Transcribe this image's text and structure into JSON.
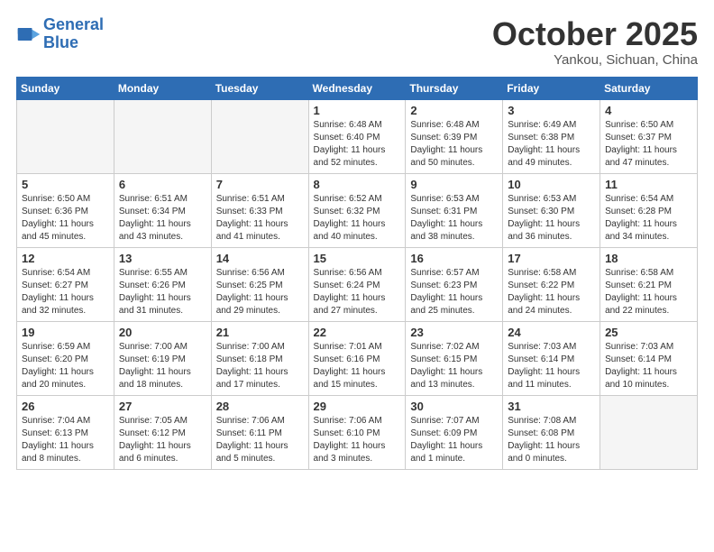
{
  "header": {
    "logo_line1": "General",
    "logo_line2": "Blue",
    "month": "October 2025",
    "location": "Yankou, Sichuan, China"
  },
  "weekdays": [
    "Sunday",
    "Monday",
    "Tuesday",
    "Wednesday",
    "Thursday",
    "Friday",
    "Saturday"
  ],
  "weeks": [
    [
      {
        "day": "",
        "info": ""
      },
      {
        "day": "",
        "info": ""
      },
      {
        "day": "",
        "info": ""
      },
      {
        "day": "1",
        "info": "Sunrise: 6:48 AM\nSunset: 6:40 PM\nDaylight: 11 hours\nand 52 minutes."
      },
      {
        "day": "2",
        "info": "Sunrise: 6:48 AM\nSunset: 6:39 PM\nDaylight: 11 hours\nand 50 minutes."
      },
      {
        "day": "3",
        "info": "Sunrise: 6:49 AM\nSunset: 6:38 PM\nDaylight: 11 hours\nand 49 minutes."
      },
      {
        "day": "4",
        "info": "Sunrise: 6:50 AM\nSunset: 6:37 PM\nDaylight: 11 hours\nand 47 minutes."
      }
    ],
    [
      {
        "day": "5",
        "info": "Sunrise: 6:50 AM\nSunset: 6:36 PM\nDaylight: 11 hours\nand 45 minutes."
      },
      {
        "day": "6",
        "info": "Sunrise: 6:51 AM\nSunset: 6:34 PM\nDaylight: 11 hours\nand 43 minutes."
      },
      {
        "day": "7",
        "info": "Sunrise: 6:51 AM\nSunset: 6:33 PM\nDaylight: 11 hours\nand 41 minutes."
      },
      {
        "day": "8",
        "info": "Sunrise: 6:52 AM\nSunset: 6:32 PM\nDaylight: 11 hours\nand 40 minutes."
      },
      {
        "day": "9",
        "info": "Sunrise: 6:53 AM\nSunset: 6:31 PM\nDaylight: 11 hours\nand 38 minutes."
      },
      {
        "day": "10",
        "info": "Sunrise: 6:53 AM\nSunset: 6:30 PM\nDaylight: 11 hours\nand 36 minutes."
      },
      {
        "day": "11",
        "info": "Sunrise: 6:54 AM\nSunset: 6:28 PM\nDaylight: 11 hours\nand 34 minutes."
      }
    ],
    [
      {
        "day": "12",
        "info": "Sunrise: 6:54 AM\nSunset: 6:27 PM\nDaylight: 11 hours\nand 32 minutes."
      },
      {
        "day": "13",
        "info": "Sunrise: 6:55 AM\nSunset: 6:26 PM\nDaylight: 11 hours\nand 31 minutes."
      },
      {
        "day": "14",
        "info": "Sunrise: 6:56 AM\nSunset: 6:25 PM\nDaylight: 11 hours\nand 29 minutes."
      },
      {
        "day": "15",
        "info": "Sunrise: 6:56 AM\nSunset: 6:24 PM\nDaylight: 11 hours\nand 27 minutes."
      },
      {
        "day": "16",
        "info": "Sunrise: 6:57 AM\nSunset: 6:23 PM\nDaylight: 11 hours\nand 25 minutes."
      },
      {
        "day": "17",
        "info": "Sunrise: 6:58 AM\nSunset: 6:22 PM\nDaylight: 11 hours\nand 24 minutes."
      },
      {
        "day": "18",
        "info": "Sunrise: 6:58 AM\nSunset: 6:21 PM\nDaylight: 11 hours\nand 22 minutes."
      }
    ],
    [
      {
        "day": "19",
        "info": "Sunrise: 6:59 AM\nSunset: 6:20 PM\nDaylight: 11 hours\nand 20 minutes."
      },
      {
        "day": "20",
        "info": "Sunrise: 7:00 AM\nSunset: 6:19 PM\nDaylight: 11 hours\nand 18 minutes."
      },
      {
        "day": "21",
        "info": "Sunrise: 7:00 AM\nSunset: 6:18 PM\nDaylight: 11 hours\nand 17 minutes."
      },
      {
        "day": "22",
        "info": "Sunrise: 7:01 AM\nSunset: 6:16 PM\nDaylight: 11 hours\nand 15 minutes."
      },
      {
        "day": "23",
        "info": "Sunrise: 7:02 AM\nSunset: 6:15 PM\nDaylight: 11 hours\nand 13 minutes."
      },
      {
        "day": "24",
        "info": "Sunrise: 7:03 AM\nSunset: 6:14 PM\nDaylight: 11 hours\nand 11 minutes."
      },
      {
        "day": "25",
        "info": "Sunrise: 7:03 AM\nSunset: 6:14 PM\nDaylight: 11 hours\nand 10 minutes."
      }
    ],
    [
      {
        "day": "26",
        "info": "Sunrise: 7:04 AM\nSunset: 6:13 PM\nDaylight: 11 hours\nand 8 minutes."
      },
      {
        "day": "27",
        "info": "Sunrise: 7:05 AM\nSunset: 6:12 PM\nDaylight: 11 hours\nand 6 minutes."
      },
      {
        "day": "28",
        "info": "Sunrise: 7:06 AM\nSunset: 6:11 PM\nDaylight: 11 hours\nand 5 minutes."
      },
      {
        "day": "29",
        "info": "Sunrise: 7:06 AM\nSunset: 6:10 PM\nDaylight: 11 hours\nand 3 minutes."
      },
      {
        "day": "30",
        "info": "Sunrise: 7:07 AM\nSunset: 6:09 PM\nDaylight: 11 hours\nand 1 minute."
      },
      {
        "day": "31",
        "info": "Sunrise: 7:08 AM\nSunset: 6:08 PM\nDaylight: 11 hours\nand 0 minutes."
      },
      {
        "day": "",
        "info": ""
      }
    ]
  ]
}
